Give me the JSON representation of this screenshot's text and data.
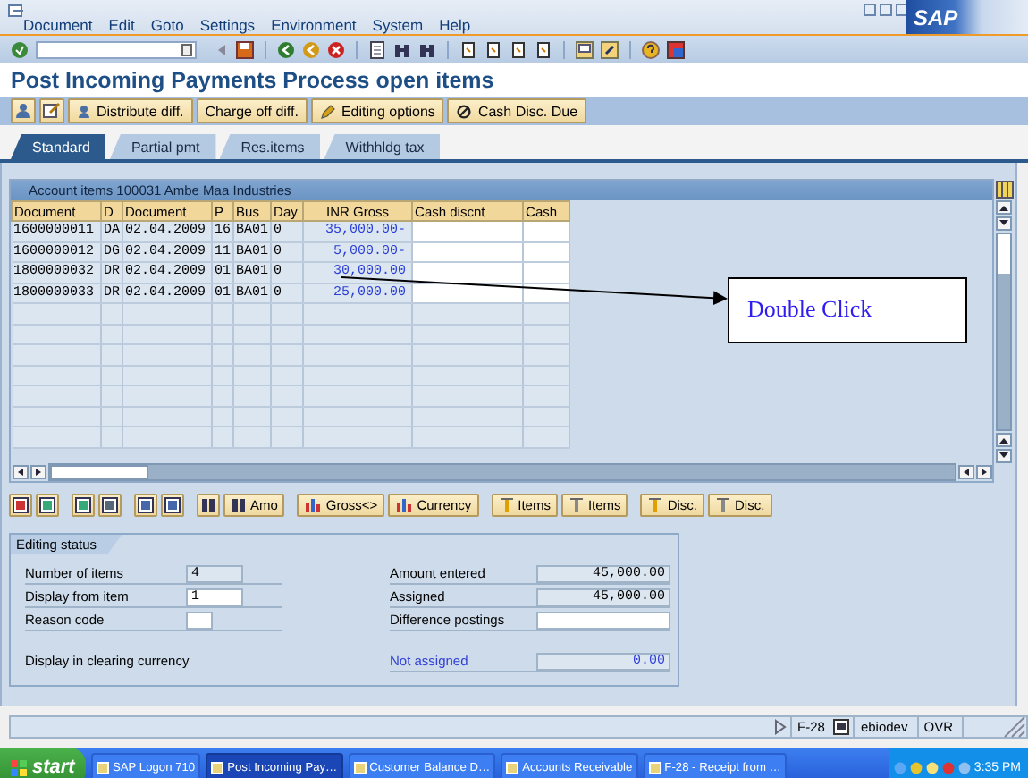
{
  "menu": [
    "Document",
    "Edit",
    "Goto",
    "Settings",
    "Environment",
    "System",
    "Help"
  ],
  "logo": "SAP",
  "title": "Post Incoming Payments Process open items",
  "app_toolbar": [
    "Distribute diff.",
    "Charge off diff.",
    "Editing options",
    "Cash Disc. Due"
  ],
  "tabs": [
    {
      "label": "Standard",
      "selected": true
    },
    {
      "label": "Partial pmt",
      "selected": false
    },
    {
      "label": "Res.items",
      "selected": false
    },
    {
      "label": "Withhldg tax",
      "selected": false
    }
  ],
  "table": {
    "title": "Account items 100031 Ambe Maa Industries",
    "columns": [
      {
        "label": "Document",
        "kind": "text"
      },
      {
        "label": "D",
        "kind": "text"
      },
      {
        "label": "Document",
        "kind": "text"
      },
      {
        "label": "P",
        "kind": "text"
      },
      {
        "label": "Bus",
        "kind": "text"
      },
      {
        "label": "Day",
        "kind": "text"
      },
      {
        "label": "INR Gross",
        "kind": "amount"
      },
      {
        "label": "Cash discnt",
        "kind": "input"
      },
      {
        "label": "Cash",
        "kind": "input"
      }
    ],
    "rows": [
      [
        "1600000011",
        "DA",
        "02.04.2009",
        "16",
        "BA01",
        "0",
        "35,000.00-",
        "",
        ""
      ],
      [
        "1600000012",
        "DG",
        "02.04.2009",
        "11",
        "BA01",
        "0",
        "5,000.00-",
        "",
        ""
      ],
      [
        "1800000032",
        "DR",
        "02.04.2009",
        "01",
        "BA01",
        "0",
        "30,000.00",
        "",
        ""
      ],
      [
        "1800000033",
        "DR",
        "02.04.2009",
        "01",
        "BA01",
        "0",
        "25,000.00",
        "",
        ""
      ]
    ]
  },
  "annotation": {
    "text": "Double Click"
  },
  "table_buttons": [
    "Amo",
    "Gross<>",
    "Currency",
    "Items",
    "Items",
    "Disc.",
    "Disc."
  ],
  "editing_status": {
    "title": "Editing status",
    "left": [
      {
        "label": "Number of items",
        "value": "4",
        "kind": "display",
        "emphasis": false
      },
      {
        "label": "Display from item",
        "value": "1",
        "kind": "input",
        "emphasis": false
      },
      {
        "label": "Reason code",
        "kind": "short-input",
        "emphasis": false
      },
      {
        "label": "Display in clearing currency",
        "kind": "label",
        "emphasis": false
      }
    ],
    "right": [
      {
        "label": "Amount entered",
        "value": "45,000.00",
        "kind": "display",
        "emphasis": false
      },
      {
        "label": "Assigned",
        "value": "45,000.00",
        "kind": "display",
        "emphasis": false
      },
      {
        "label": "Difference postings",
        "kind": "input",
        "emphasis": false
      },
      {
        "label": "Not assigned",
        "value": "0.00",
        "kind": "display",
        "emphasis": true
      }
    ]
  },
  "status_bar": {
    "transaction": "F-28",
    "user": "ebiodev",
    "mode": "OVR"
  },
  "taskbar": {
    "start": "start",
    "items": [
      {
        "label": "SAP Logon 710",
        "selected": false
      },
      {
        "label": "Post Incoming Pay…",
        "selected": true
      },
      {
        "label": "Customer Balance D…",
        "selected": false
      },
      {
        "label": "Accounts Receivable",
        "selected": false
      },
      {
        "label": "F-28 - Receipt from …",
        "selected": false
      }
    ],
    "clock": "3:35 PM"
  }
}
